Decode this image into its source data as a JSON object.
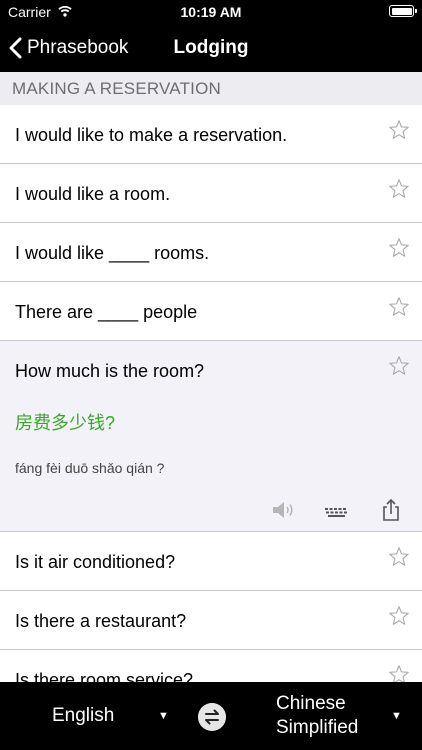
{
  "status": {
    "carrier": "Carrier",
    "time": "10:19 AM",
    "battery_level": 1.0
  },
  "nav": {
    "back_label": "Phrasebook",
    "title": "Lodging"
  },
  "section": {
    "header": "MAKING A RESERVATION"
  },
  "phrases": [
    {
      "text": "I would like to make a reservation."
    },
    {
      "text": "I would like a room."
    },
    {
      "text": "I would like ____ rooms."
    },
    {
      "text": "There are ____ people"
    },
    {
      "text": "How much is the room?",
      "translation": "房费多少钱?",
      "pinyin": "fáng fèi duō shǎo qián ?"
    },
    {
      "text": "Is it air conditioned?"
    },
    {
      "text": "Is there a restaurant?"
    },
    {
      "text": "Is there room service?"
    }
  ],
  "actions": {
    "icons": [
      "speaker-icon",
      "keyboard-icon",
      "share-icon"
    ]
  },
  "bottom": {
    "source_language": "English",
    "target_language_line1": "Chinese",
    "target_language_line2": "Simplified",
    "caret": "▼"
  },
  "colors": {
    "accent_green": "#3aa62e",
    "section_bg": "#ececf1",
    "expanded_bg": "#f3f2f8",
    "bar_bg": "#000000"
  }
}
